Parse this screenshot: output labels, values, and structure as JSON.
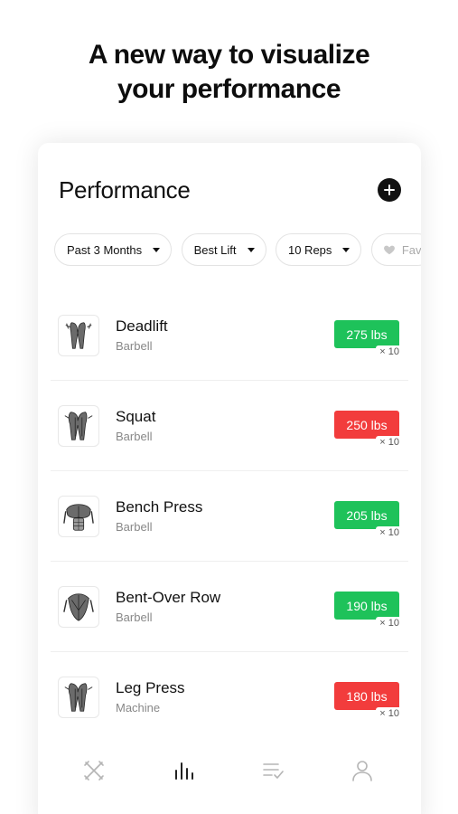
{
  "headline": {
    "line1": "A new way to visualize",
    "line2": "your performance"
  },
  "card": {
    "title": "Performance",
    "add_icon": "plus-circle-icon"
  },
  "filters": [
    {
      "label": "Past 3 Months"
    },
    {
      "label": "Best Lift"
    },
    {
      "label": "10 Reps"
    },
    {
      "label": "Fav",
      "icon": "heart-icon"
    }
  ],
  "colors": {
    "green": "#1ec25a",
    "red": "#f23c3c",
    "tab_active": "#222222",
    "tab_inactive": "#b5b5b5"
  },
  "exercises": [
    {
      "name": "Deadlift",
      "equipment": "Barbell",
      "weight": "275 lbs",
      "reps": "× 10",
      "status": "green",
      "icon": "legs-back-muscle-icon"
    },
    {
      "name": "Squat",
      "equipment": "Barbell",
      "weight": "250 lbs",
      "reps": "× 10",
      "status": "red",
      "icon": "legs-front-muscle-icon"
    },
    {
      "name": "Bench Press",
      "equipment": "Barbell",
      "weight": "205 lbs",
      "reps": "× 10",
      "status": "green",
      "icon": "chest-muscle-icon"
    },
    {
      "name": "Bent-Over Row",
      "equipment": "Barbell",
      "weight": "190 lbs",
      "reps": "× 10",
      "status": "green",
      "icon": "back-muscle-icon"
    },
    {
      "name": "Leg Press",
      "equipment": "Machine",
      "weight": "180 lbs",
      "reps": "× 10",
      "status": "red",
      "icon": "legs-front-muscle-icon"
    }
  ],
  "tabs": [
    {
      "icon": "workout-icon",
      "active": false
    },
    {
      "icon": "bar-chart-icon",
      "active": true
    },
    {
      "icon": "checklist-icon",
      "active": false
    },
    {
      "icon": "profile-icon",
      "active": false
    }
  ]
}
